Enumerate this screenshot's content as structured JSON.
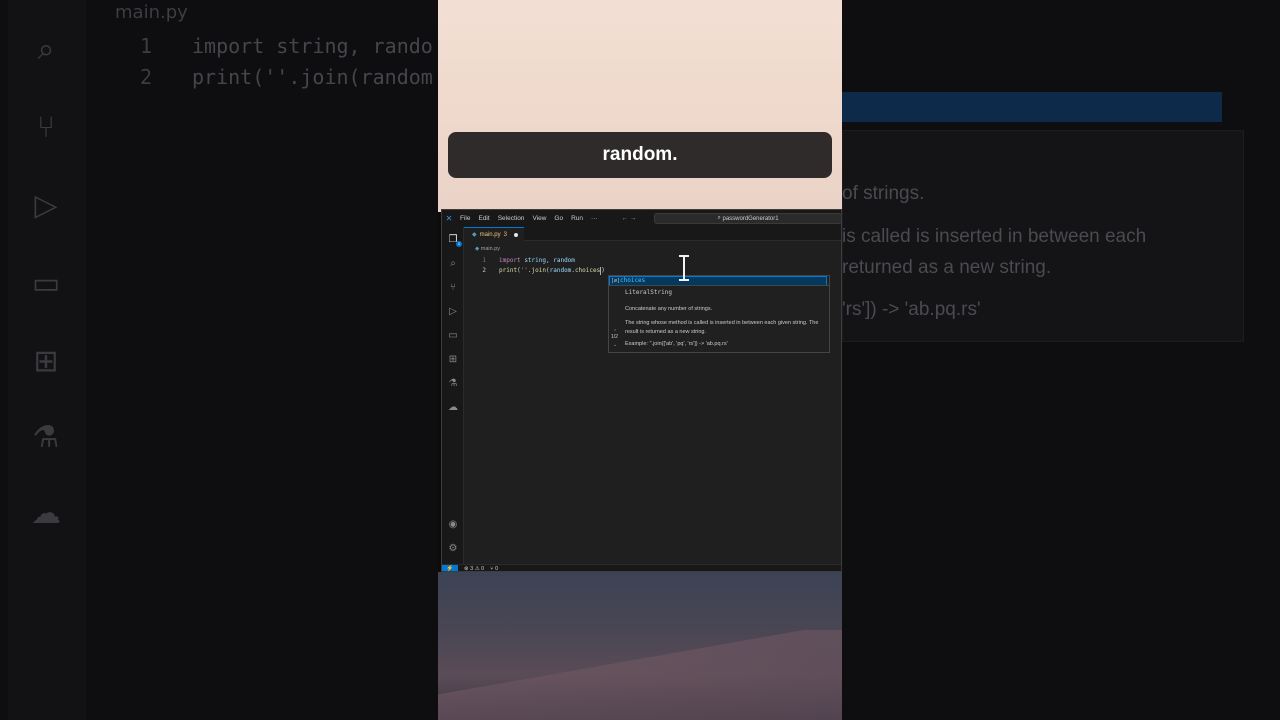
{
  "caption": "random.",
  "titlebar": {
    "menus": [
      "File",
      "Edit",
      "Selection",
      "View",
      "Go",
      "Run",
      "···"
    ],
    "arrows": "← →",
    "search_text": "passwordGenerator1"
  },
  "tab": {
    "filename": "main.py",
    "problems": "3"
  },
  "breadcrumb": "main.py",
  "code": {
    "lines": [
      {
        "num": "1",
        "kw": "import",
        "rest_a": "string",
        "sep": ", ",
        "rest_b": "random"
      },
      {
        "num": "2",
        "fn": "print",
        "open": "(",
        "str": "''",
        "dot": ".",
        "join": "join",
        "paren": "(",
        "mod": "random",
        "dot2": ".",
        "attr": "choices",
        "close": ")"
      }
    ]
  },
  "suggest": {
    "kind": "[ø]",
    "item": "choices",
    "signature": "LiteralString",
    "detail_1": "Concatenate any number of strings.",
    "detail_2": "The string whose method is called is inserted in between each given string. The result is returned as a new string.",
    "detail_3": "Example: ''.join(['ab', 'pq', 'rs']) -> 'ab.pq.rs'",
    "pager": "1/2"
  },
  "status": {
    "errors": "⊗ 3 ⚠ 0",
    "ports": "⑂ 0"
  },
  "background": {
    "tab": "main.py",
    "line1_num": "1",
    "line1": "import string, rando",
    "line2_num": "2",
    "line2": "print(''.join(random",
    "right_1": "of strings.",
    "right_2": "is called is inserted in between each",
    "right_3": "returned as a new string.",
    "right_4": "'rs']) -> 'ab.pq.rs'"
  }
}
